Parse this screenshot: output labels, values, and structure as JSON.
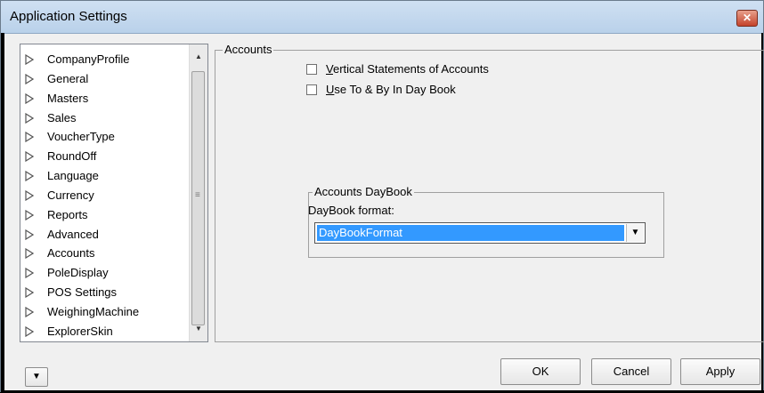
{
  "window": {
    "title": "Application Settings",
    "close_label": "✕"
  },
  "tree": {
    "items": [
      {
        "label": "CompanyProfile"
      },
      {
        "label": "General"
      },
      {
        "label": "Masters"
      },
      {
        "label": "Sales"
      },
      {
        "label": "VoucherType"
      },
      {
        "label": "RoundOff"
      },
      {
        "label": "Language"
      },
      {
        "label": "Currency"
      },
      {
        "label": "Reports"
      },
      {
        "label": "Advanced"
      },
      {
        "label": "Accounts"
      },
      {
        "label": "PoleDisplay"
      },
      {
        "label": "POS Settings"
      },
      {
        "label": "WeighingMachine"
      },
      {
        "label": "ExplorerSkin"
      }
    ],
    "selected": "Accounts"
  },
  "accounts": {
    "group_label": "Accounts",
    "option1_label": "Vertical Statements of Accounts",
    "option1_checked": false,
    "option2_label": "Use To & By In Day Book",
    "option2_checked": false
  },
  "daybook": {
    "group_label": "Accounts DayBook",
    "format_label": "DayBook format:",
    "format_value": "DayBookFormat"
  },
  "buttons": {
    "ok": "OK",
    "cancel": "Cancel",
    "apply": "Apply"
  }
}
